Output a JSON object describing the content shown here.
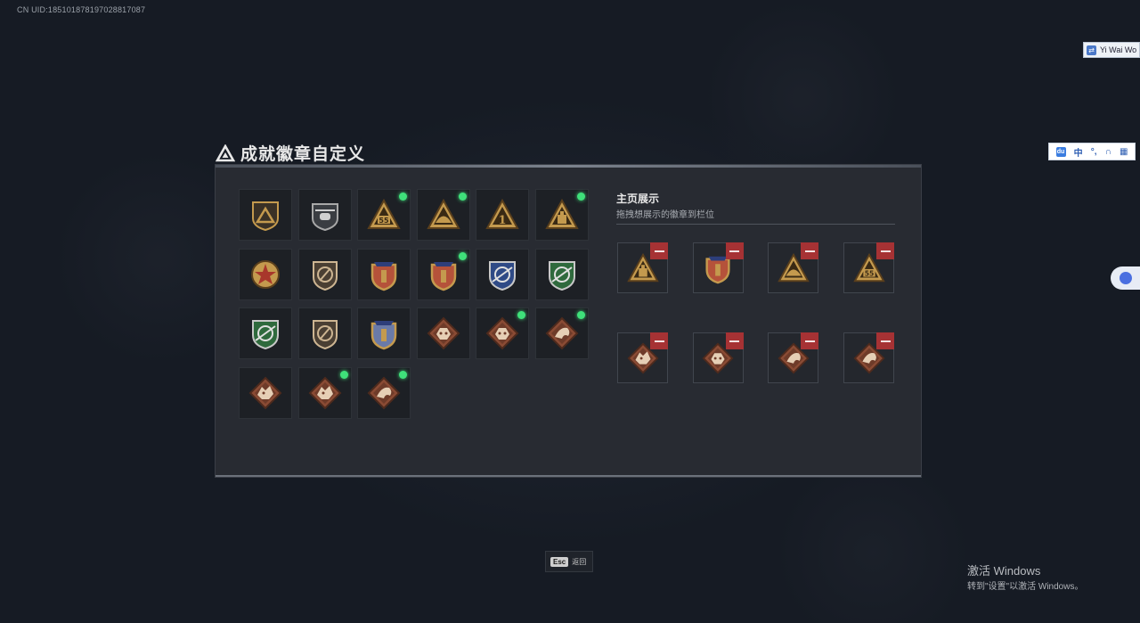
{
  "overlay": {
    "uid_text": "CN UID:185101878197028817087"
  },
  "window": {
    "title": "成就徽章自定义"
  },
  "badges": [
    {
      "icon": "mountain-shield-badge",
      "new": false
    },
    {
      "icon": "helicopter-badge",
      "new": false
    },
    {
      "icon": "triangle-55-badge",
      "new": true
    },
    {
      "icon": "triangle-helmet-badge",
      "new": true
    },
    {
      "icon": "triangle-number-one-badge",
      "new": false
    },
    {
      "icon": "triangle-crate-badge",
      "new": true
    },
    {
      "icon": "star-medal-badge",
      "new": false
    },
    {
      "icon": "shield-wings-badge",
      "new": false
    },
    {
      "icon": "crest-gold-badge",
      "new": false
    },
    {
      "icon": "crest-star-badge",
      "new": true
    },
    {
      "icon": "blue-crosshair-badge",
      "new": false
    },
    {
      "icon": "green-rifle-badge",
      "new": false
    },
    {
      "icon": "green-crosshair-badge",
      "new": false
    },
    {
      "icon": "slash-shield-badge",
      "new": false
    },
    {
      "icon": "laurel-rifle-badge",
      "new": false
    },
    {
      "icon": "beast-diamond-badge",
      "new": false
    },
    {
      "icon": "beast-diamond-badge",
      "new": true
    },
    {
      "icon": "rider-diamond-badge",
      "new": true
    },
    {
      "icon": "dragon-diamond-badge",
      "new": false
    },
    {
      "icon": "dragon-diamond-badge",
      "new": true
    },
    {
      "icon": "rider-diamond-badge",
      "new": true
    }
  ],
  "showcase": {
    "title": "主页展示",
    "subtitle": "拖拽想展示的徽章到栏位",
    "slots": [
      {
        "icon": "triangle-crate-badge"
      },
      {
        "icon": "crest-star-badge"
      },
      {
        "icon": "triangle-helmet-badge"
      },
      {
        "icon": "triangle-55-badge"
      },
      {
        "icon": "dragon-diamond-badge"
      },
      {
        "icon": "beast-diamond-badge"
      },
      {
        "icon": "rider-diamond-badge"
      },
      {
        "icon": "rider-diamond-badge"
      }
    ]
  },
  "footer": {
    "esc_key": "Esc",
    "esc_label": "返回"
  },
  "system": {
    "activate_title": "激活 Windows",
    "activate_sub": "转到\"设置\"以激活 Windows。",
    "ime_top_label": "Yi Wai Wo",
    "ime_bar_label": "中"
  },
  "colors": {
    "new_dot": "#3fe07a",
    "remove": "#a63234",
    "gold": "#c49a4e",
    "bronze": "#8a4b34"
  }
}
